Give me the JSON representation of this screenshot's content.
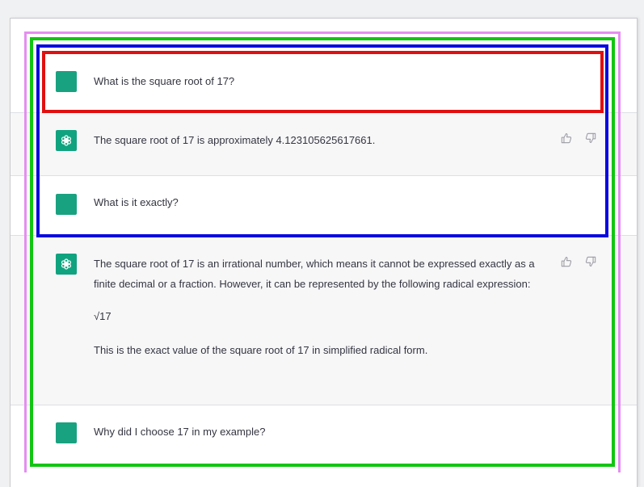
{
  "conversation": {
    "messages": [
      {
        "role": "user",
        "text": "What is the square root of 17?"
      },
      {
        "role": "assistant",
        "text": "The square root of 17 is approximately 4.123105625617661."
      },
      {
        "role": "user",
        "text": "What is it exactly?"
      },
      {
        "role": "assistant",
        "paragraphs": [
          "The square root of 17 is an irrational number, which means it cannot be expressed exactly as a finite decimal or a fraction. However, it can be represented by the following radical expression:",
          "√17",
          "This is the exact value of the square root of 17 in simplified radical form."
        ]
      },
      {
        "role": "user",
        "text": "Why did I choose 17 in my example?"
      }
    ]
  },
  "icons": {
    "assistant_avatar": "openai-logo-icon",
    "thumbs_up": "thumbs-up-icon",
    "thumbs_down": "thumbs-down-icon"
  },
  "colors": {
    "user_avatar": "#19a27f",
    "assistant_avatar": "#10a37f",
    "assistant_row_bg": "#f7f7f8",
    "overlay_violet": "#e58ef0",
    "overlay_green": "#12c512",
    "overlay_blue": "#0a0ae0",
    "overlay_red": "#e01010"
  }
}
